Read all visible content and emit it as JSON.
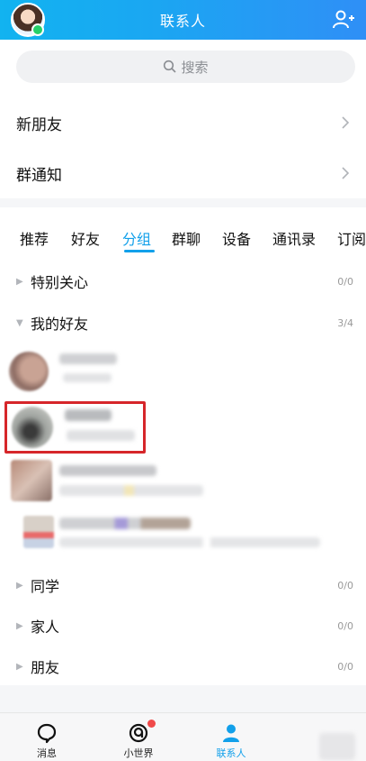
{
  "header": {
    "title": "联系人"
  },
  "search": {
    "placeholder": "搜索"
  },
  "rows": {
    "new_friends": "新朋友",
    "group_notice": "群通知"
  },
  "tabs": [
    {
      "label": "推荐"
    },
    {
      "label": "好友"
    },
    {
      "label": "分组",
      "active": true
    },
    {
      "label": "群聊"
    },
    {
      "label": "设备"
    },
    {
      "label": "通讯录"
    },
    {
      "label": "订阅"
    }
  ],
  "groups": [
    {
      "name": "特别关心",
      "count": "0/0",
      "expanded": false
    },
    {
      "name": "我的好友",
      "count": "3/4",
      "expanded": true
    },
    {
      "name": "同学",
      "count": "0/0",
      "expanded": false
    },
    {
      "name": "家人",
      "count": "0/0",
      "expanded": false
    },
    {
      "name": "朋友",
      "count": "0/0",
      "expanded": false
    }
  ],
  "bottom_nav": [
    {
      "label": "消息",
      "icon": "message-icon"
    },
    {
      "label": "小世界",
      "icon": "small-world-icon",
      "has_badge": true
    },
    {
      "label": "联系人",
      "icon": "contacts-icon",
      "active": true
    }
  ],
  "colors": {
    "accent": "#12a0ea",
    "header_start": "#12b3f0",
    "header_end": "#2f8ff6",
    "highlight_border": "#d6262a"
  }
}
